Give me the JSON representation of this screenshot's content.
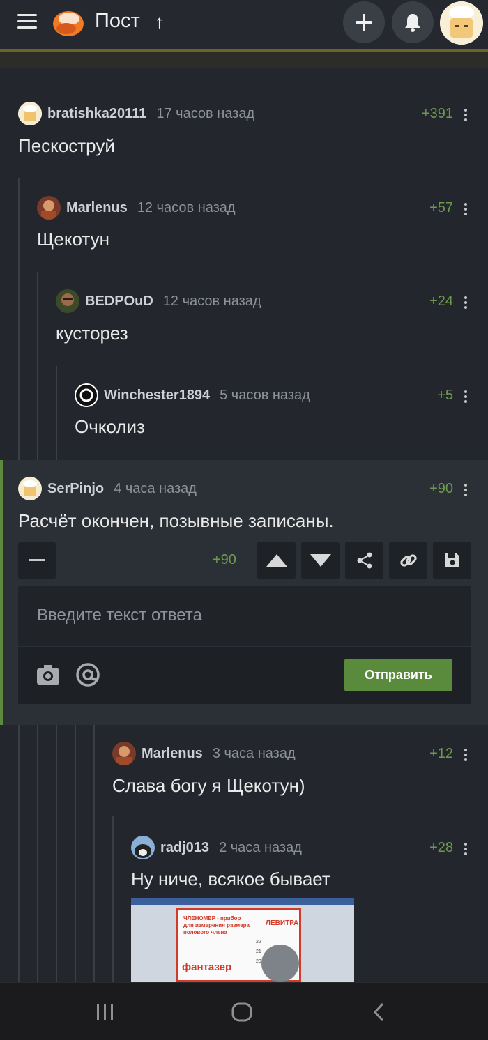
{
  "header": {
    "title": "Пост",
    "icons": [
      "menu-icon",
      "logo",
      "arrow-up-icon",
      "plus-icon",
      "bell-icon",
      "avatar"
    ]
  },
  "comments": [
    {
      "user": "bratishka20111",
      "time": "17 часов назад",
      "rating": "+391",
      "text": "Пескоструй"
    },
    {
      "user": "Marlenus",
      "time": "12 часов назад",
      "rating": "+57",
      "text": "Щекотун"
    },
    {
      "user": "BEDPOuD",
      "time": "12 часов назад",
      "rating": "+24",
      "text": "кусторез"
    },
    {
      "user": "Winchester1894",
      "time": "5 часов назад",
      "rating": "+5",
      "text": "Очколиз"
    },
    {
      "user": "SerPinjo",
      "time": "4 часа назад",
      "rating": "+90",
      "text": "Расчёт окончен, позывные записаны."
    },
    {
      "user": "Marlenus",
      "time": "3 часа назад",
      "rating": "+12",
      "text": "Слава богу я Щекотун)"
    },
    {
      "user": "radj013",
      "time": "2 часа назад",
      "rating": "+28",
      "text": "Ну ниче, всякое бывает"
    }
  ],
  "actions": {
    "rating": "+90",
    "reply_placeholder": "Введите текст ответа",
    "send_label": "Отправить"
  },
  "image_text": {
    "line1": "ЧЛЕНОМЕР - прибор",
    "line2": "для измерения размера",
    "line3": "полового члена",
    "brand": "ЛЕВИТРА",
    "label": "фантазер",
    "ticks": [
      "22",
      "21",
      "20"
    ]
  },
  "colors": {
    "accent": "#5a8a3c",
    "rating": "#6e9a4f",
    "background": "#23272d"
  }
}
